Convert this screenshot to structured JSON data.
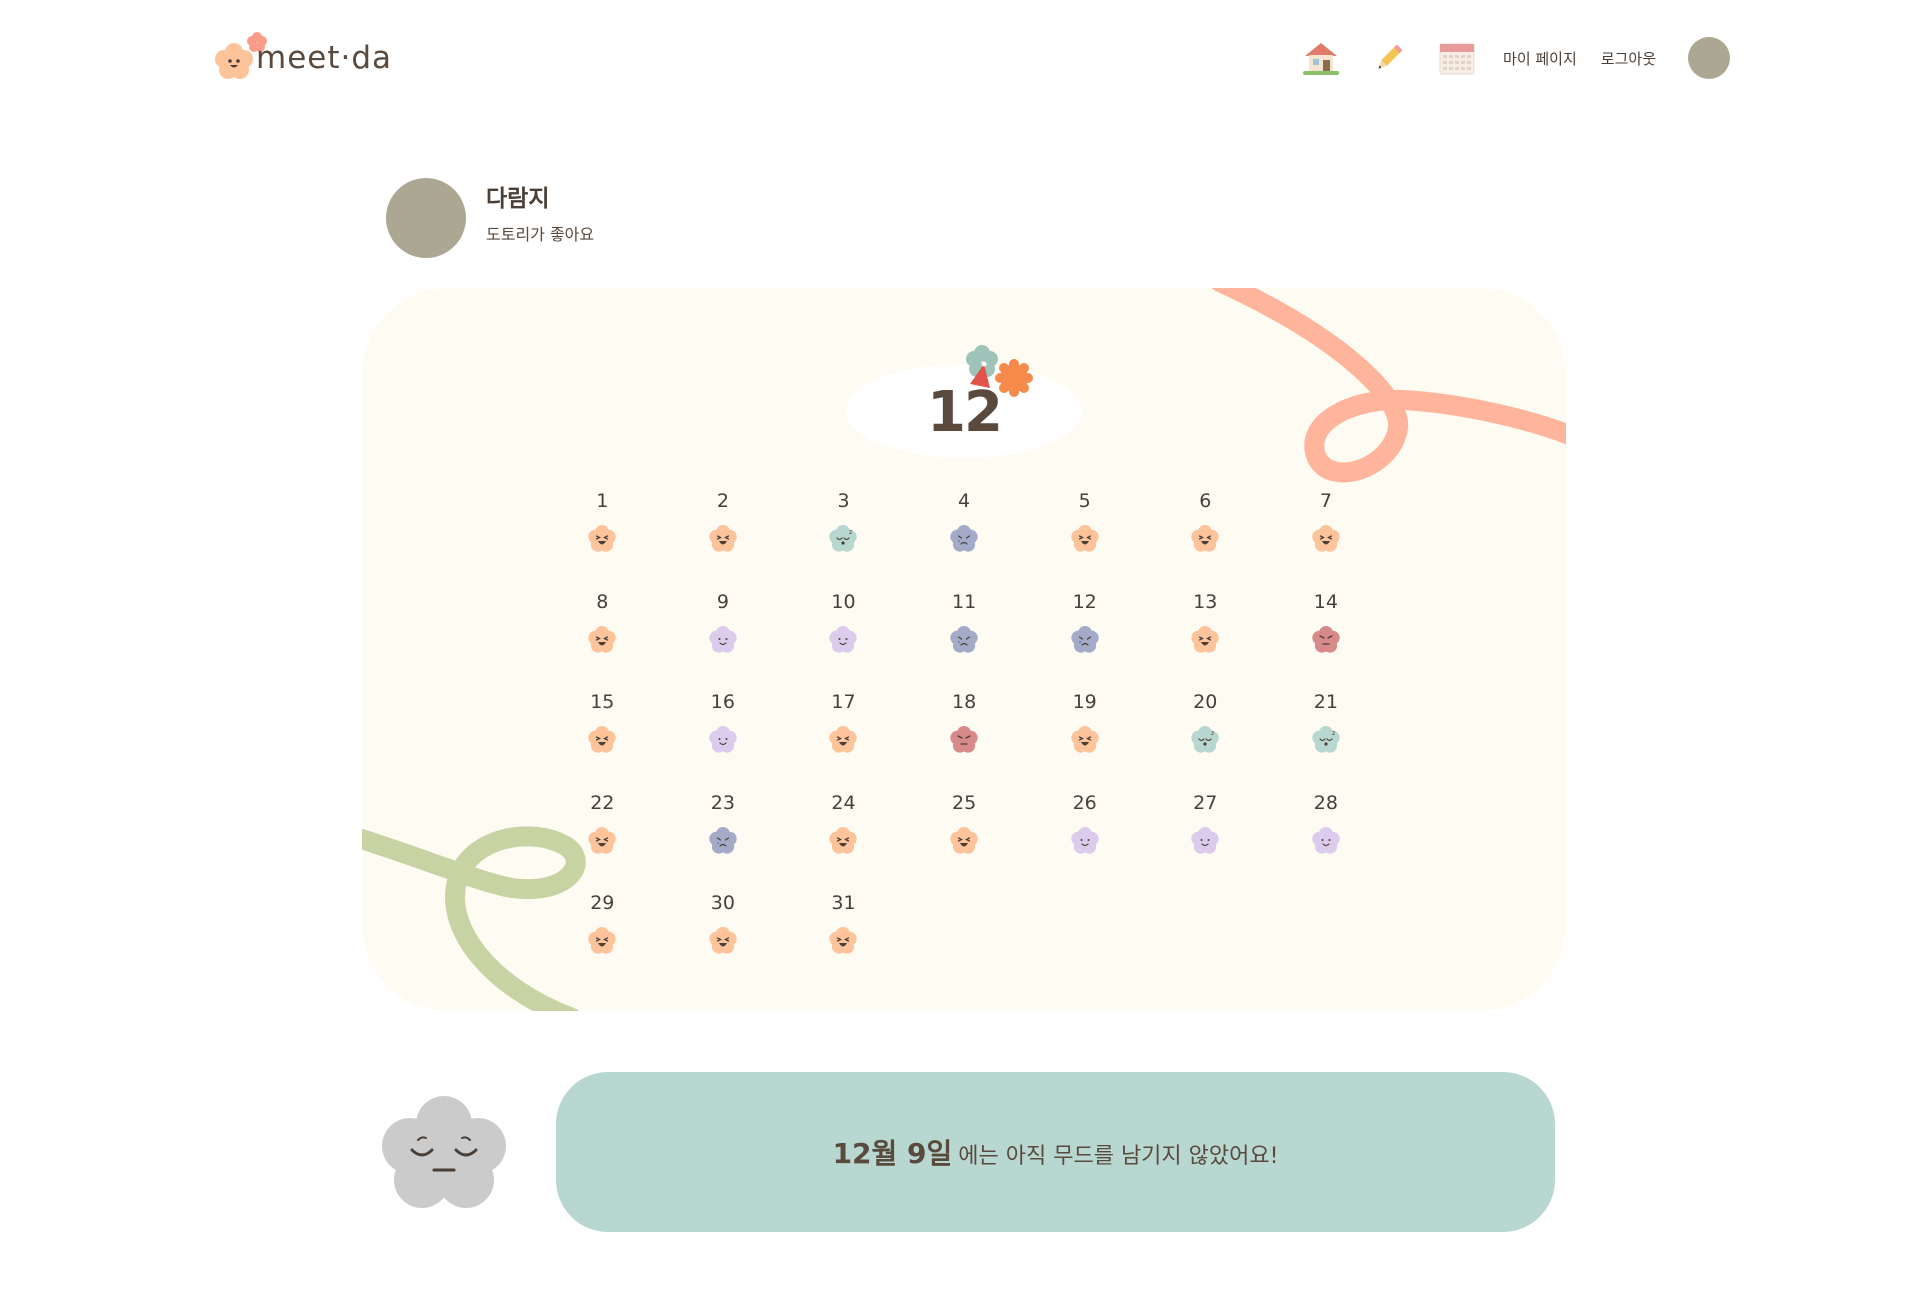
{
  "app": {
    "logo_text": "meet·da"
  },
  "nav": {
    "home_icon": "house-icon",
    "write_icon": "pencil-icon",
    "calendar_icon": "calendar-icon",
    "mypage_label": "마이 페이지",
    "logout_label": "로그아웃"
  },
  "profile": {
    "name": "다람지",
    "bio": "도토리가 좋아요"
  },
  "calendar": {
    "month": "12",
    "days": [
      {
        "day": "1",
        "mood": "happy"
      },
      {
        "day": "2",
        "mood": "happy"
      },
      {
        "day": "3",
        "mood": "sleepy"
      },
      {
        "day": "4",
        "mood": "sad"
      },
      {
        "day": "5",
        "mood": "happy"
      },
      {
        "day": "6",
        "mood": "happy"
      },
      {
        "day": "7",
        "mood": "happy"
      },
      {
        "day": "8",
        "mood": "happy"
      },
      {
        "day": "9",
        "mood": "calm"
      },
      {
        "day": "10",
        "mood": "calm"
      },
      {
        "day": "11",
        "mood": "sad"
      },
      {
        "day": "12",
        "mood": "sad"
      },
      {
        "day": "13",
        "mood": "happy"
      },
      {
        "day": "14",
        "mood": "angry"
      },
      {
        "day": "15",
        "mood": "happy"
      },
      {
        "day": "16",
        "mood": "calm"
      },
      {
        "day": "17",
        "mood": "happy"
      },
      {
        "day": "18",
        "mood": "angry"
      },
      {
        "day": "19",
        "mood": "happy"
      },
      {
        "day": "20",
        "mood": "sleepy"
      },
      {
        "day": "21",
        "mood": "sleepy"
      },
      {
        "day": "22",
        "mood": "happy"
      },
      {
        "day": "23",
        "mood": "sad"
      },
      {
        "day": "24",
        "mood": "happy"
      },
      {
        "day": "25",
        "mood": "happy"
      },
      {
        "day": "26",
        "mood": "calm"
      },
      {
        "day": "27",
        "mood": "calm"
      },
      {
        "day": "28",
        "mood": "calm"
      },
      {
        "day": "29",
        "mood": "happy"
      },
      {
        "day": "30",
        "mood": "happy"
      },
      {
        "day": "31",
        "mood": "happy"
      }
    ]
  },
  "moods": {
    "happy": {
      "color": "#fdc39a"
    },
    "calm": {
      "color": "#dccbec"
    },
    "sleepy": {
      "color": "#b7d7d0"
    },
    "sad": {
      "color": "#a3abc9"
    },
    "angry": {
      "color": "#d88a8a"
    }
  },
  "selected": {
    "date_label": "12월 9일",
    "message": "에는 아직 무드를 남기지 않았어요!",
    "mood_icon": "sleepy-cloud-icon"
  },
  "colors": {
    "accent_orange": "#ffb59c",
    "accent_green": "#c7d3a2",
    "message_bg": "#b7d7d0",
    "avatar": "#aca792",
    "card_bg": "#fefbf3"
  }
}
